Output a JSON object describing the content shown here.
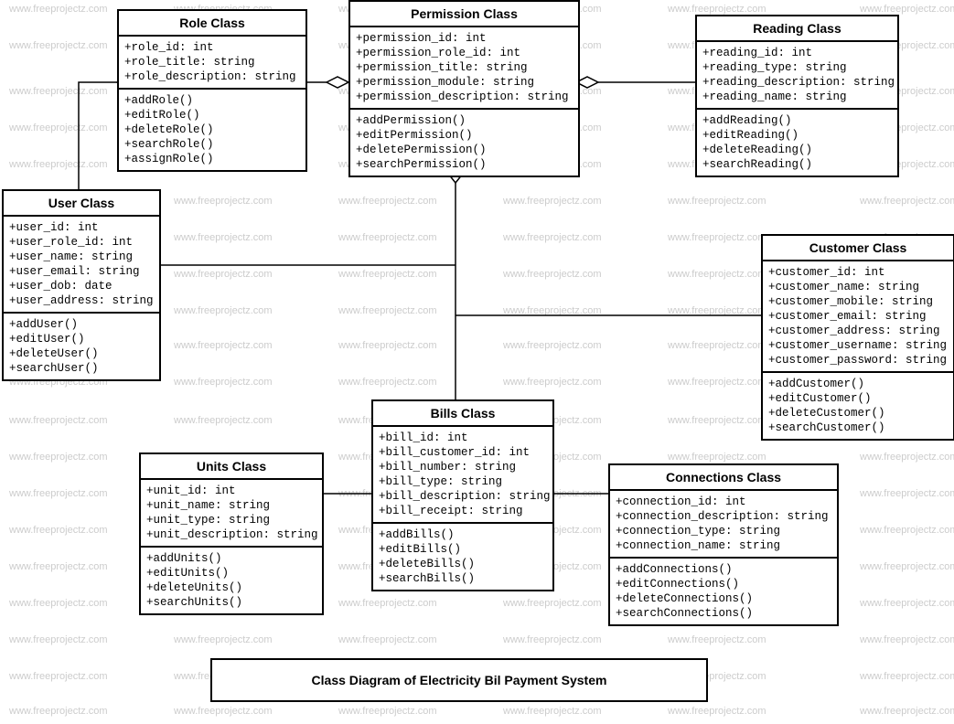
{
  "watermark_text": "www.freeprojectz.com",
  "footer_title": "Class Diagram of Electricity Bil Payment System",
  "classes": {
    "role": {
      "title": "Role Class",
      "attrs": [
        "+role_id: int",
        "+role_title: string",
        "+role_description: string"
      ],
      "methods": [
        "+addRole()",
        "+editRole()",
        "+deleteRole()",
        "+searchRole()",
        "+assignRole()"
      ]
    },
    "permission": {
      "title": "Permission Class",
      "attrs": [
        "+permission_id: int",
        "+permission_role_id: int",
        "+permission_title: string",
        "+permission_module: string",
        "+permission_description: string"
      ],
      "methods": [
        "+addPermission()",
        "+editPermission()",
        "+deletePermission()",
        "+searchPermission()"
      ]
    },
    "reading": {
      "title": "Reading Class",
      "attrs": [
        "+reading_id: int",
        "+reading_type: string",
        "+reading_description: string",
        "+reading_name: string"
      ],
      "methods": [
        "+addReading()",
        "+editReading()",
        "+deleteReading()",
        "+searchReading()"
      ]
    },
    "user": {
      "title": "User Class",
      "attrs": [
        "+user_id: int",
        "+user_role_id: int",
        "+user_name: string",
        "+user_email: string",
        "+user_dob: date",
        "+user_address: string"
      ],
      "methods": [
        "+addUser()",
        "+editUser()",
        "+deleteUser()",
        "+searchUser()"
      ]
    },
    "customer": {
      "title": "Customer Class",
      "attrs": [
        "+customer_id: int",
        "+customer_name: string",
        "+customer_mobile: string",
        "+customer_email: string",
        "+customer_address: string",
        "+customer_username: string",
        "+customer_password: string"
      ],
      "methods": [
        "+addCustomer()",
        "+editCustomer()",
        "+deleteCustomer()",
        "+searchCustomer()"
      ]
    },
    "bills": {
      "title": "Bills Class",
      "attrs": [
        "+bill_id: int",
        "+bill_customer_id: int",
        "+bill_number: string",
        "+bill_type: string",
        "+bill_description: string",
        "+bill_receipt: string"
      ],
      "methods": [
        "+addBills()",
        "+editBills()",
        "+deleteBills()",
        "+searchBills()"
      ]
    },
    "units": {
      "title": "Units Class",
      "attrs": [
        "+unit_id: int",
        "+unit_name: string",
        "+unit_type: string",
        "+unit_description: string"
      ],
      "methods": [
        "+addUnits()",
        "+editUnits()",
        "+deleteUnits()",
        "+searchUnits()"
      ]
    },
    "connections": {
      "title": "Connections Class",
      "attrs": [
        "+connection_id: int",
        "+connection_description: string",
        "+connection_type: string",
        "+connection_name: string"
      ],
      "methods": [
        "+addConnections()",
        "+editConnections()",
        "+deleteConnections()",
        "+searchConnections()"
      ]
    }
  }
}
